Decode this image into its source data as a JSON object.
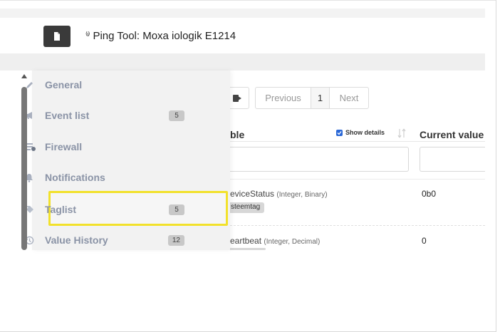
{
  "header": {
    "antenna_glyph": "⁽ᶦ⁾",
    "title": "Ping Tool: Moxa iologik E1214"
  },
  "sidebar": {
    "items": [
      {
        "label": "General",
        "icon": "pencil-icon",
        "badge": ""
      },
      {
        "label": "Event list",
        "icon": "megaphone-icon",
        "badge": "5"
      },
      {
        "label": "Firewall",
        "icon": "firewall-icon",
        "badge": ""
      },
      {
        "label": "Notifications",
        "icon": "bell-icon",
        "badge": ""
      },
      {
        "label": "Taglist",
        "icon": "tag-icon",
        "badge": "5"
      },
      {
        "label": "Value History",
        "icon": "history-icon",
        "badge": "12"
      }
    ],
    "highlighted": "Taglist"
  },
  "pager": {
    "previous": "Previous",
    "current": "1",
    "next": "Next"
  },
  "table": {
    "col_name_partial": "ble",
    "show_details": "Show details",
    "col_value": "Current value",
    "rows": [
      {
        "name_partial": "eviceStatus",
        "type": "(Integer, Binary)",
        "tag": "steemtag",
        "value": "0b0"
      },
      {
        "name_partial": "eartbeat",
        "type": "(Integer, Decimal)",
        "tag": "",
        "value": "0"
      }
    ]
  },
  "colors": {
    "highlight_border": "#f2e12b",
    "nav_text": "#8a93a6",
    "checkbox": "#2a67d6"
  }
}
